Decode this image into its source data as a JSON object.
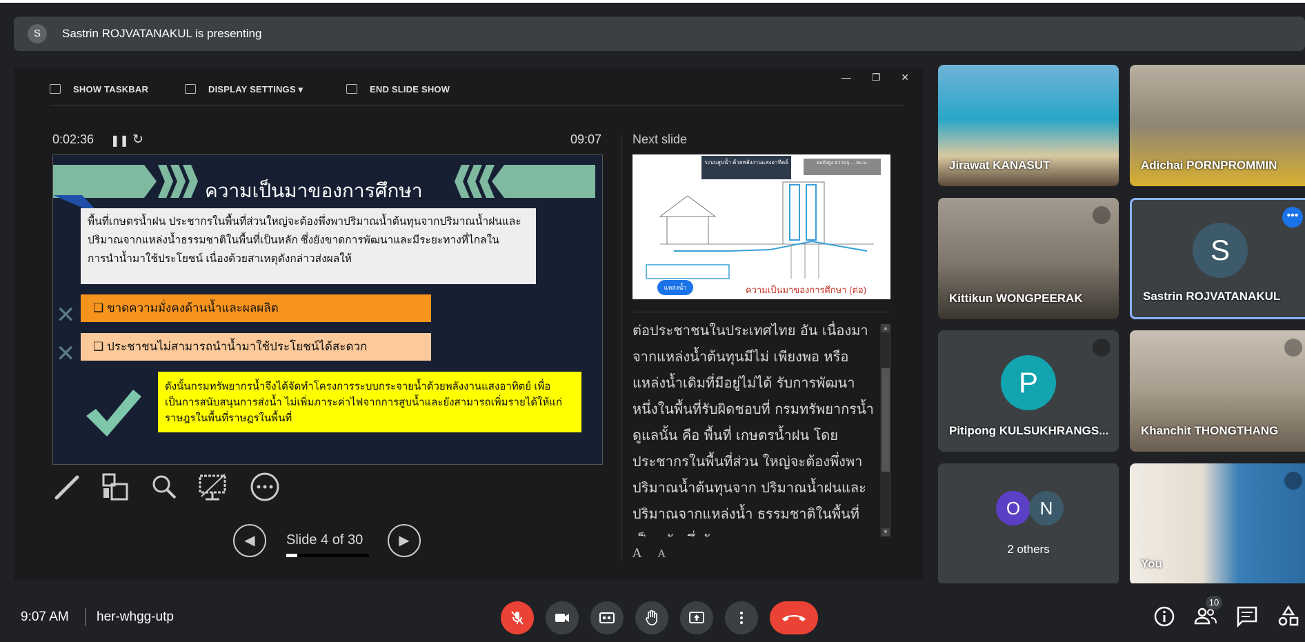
{
  "presenting_bar": {
    "avatar_letter": "S",
    "text": "Sastrin ROJVATANAKUL is presenting"
  },
  "presenter_toolbar": {
    "show_taskbar": "SHOW TASKBAR",
    "display_settings": "DISPLAY SETTINGS ▾",
    "end_slide_show": "END SLIDE SHOW"
  },
  "timer": {
    "elapsed": "0:02:36",
    "clock": "09:07"
  },
  "slide": {
    "title": "ความเป็นมาของการศึกษา",
    "paragraph": "พื้นที่เกษตรน้ำฝน ประชากรในพื้นที่ส่วนใหญ่จะต้องพึ่งพาปริมาณน้ำต้นทุนจากปริมาณน้ำฝนและปริมาณจากแหล่งน้ำธรรมชาติในพื้นที่เป็นหลัก ซึ่งยังขาดการพัฒนาและมีระยะทางที่ไกลในการนำน้ำมาใช้ประโยชน์ เนื่องด้วยสาเหตุดังกล่าวส่งผลให้",
    "bullet1": "❑  ขาดความมั่งคงด้านน้ำและผลผลิต",
    "bullet2": "❑  ประชาชนไม่สามารถนำน้ำมาใช้ประโยชน์ได้สะดวก",
    "conclusion": "ดังนั้นกรมทรัพยากรน้ำจึงได้จัดทำโครงการระบบกระจายน้ำด้วยพลังงานแสงอาทิตย์ เพื่อเป็นการสนับสนุนการส่งน้ำ ไม่เพิ่มภาระค่าไฟจากการสูบน้ำและยังสามารถเพิ่มรายได้ให้แก่ราษฎรในพื้นที่ราษฎรในพื้นที่"
  },
  "slide_nav": {
    "counter": "Slide 4 of 30",
    "progress_fraction": 0.133
  },
  "next_slide": {
    "label": "Next slide",
    "box1": "ระบบสูบน้ำ ด้วยพลังงานแสงอาทิตย์",
    "box2": "หอถังสูง ความจุ ... ลบ.ม.",
    "source_label": "แหล่งน้ำ",
    "caption": "ความเป็นมาของการศึกษา (ต่อ)"
  },
  "notes": {
    "text": "ต่อประชาชนในประเทศไทย อัน เนื่องมาจากแหล่งน้ำต้นทุนมีไม่ เพียงพอ หรือ แหล่งน้ำเดิมที่มีอยู่ไม่ได้ รับการพัฒนา หนึ่งในพื้นที่รับผิดชอบที่ กรมทรัพยากรน้ำดูแลนั้น คือ พื้นที่ เกษตรน้ำฝน โดยประชากรในพื้นที่ส่วน ใหญ่จะต้องพึ่งพาปริมาณน้ำต้นทุนจาก ปริมาณน้ำฝนและปริมาณจากแหล่งน้ำ ธรรมชาติในพื้นที่เป็นหลัก ซึ่งยังขาด",
    "font_increase": "A",
    "font_decrease": "A"
  },
  "participants": [
    {
      "name": "Jirawat KANASUT"
    },
    {
      "name": "Adichai PORNPROMMIN"
    },
    {
      "name": "Kittikun WONGPEERAK"
    },
    {
      "name": "Sastrin ROJVATANAKUL",
      "avatar_letter": "S"
    },
    {
      "name": "Pitipong KULSUKHRANGS...",
      "avatar_letter": "P"
    },
    {
      "name": "Khanchit THONGTHANG"
    },
    {
      "name": "2 others",
      "avatar1": "O",
      "avatar2": "N"
    },
    {
      "name": "You"
    }
  ],
  "bottom_bar": {
    "time": "9:07 AM",
    "meeting_code": "her-whgg-utp",
    "people_count": "10"
  },
  "colors": {
    "end_call": "#ea4335",
    "mic_off": "#ea4335",
    "accent": "#8ab4f8",
    "slide_green": "#7fb9a0"
  }
}
